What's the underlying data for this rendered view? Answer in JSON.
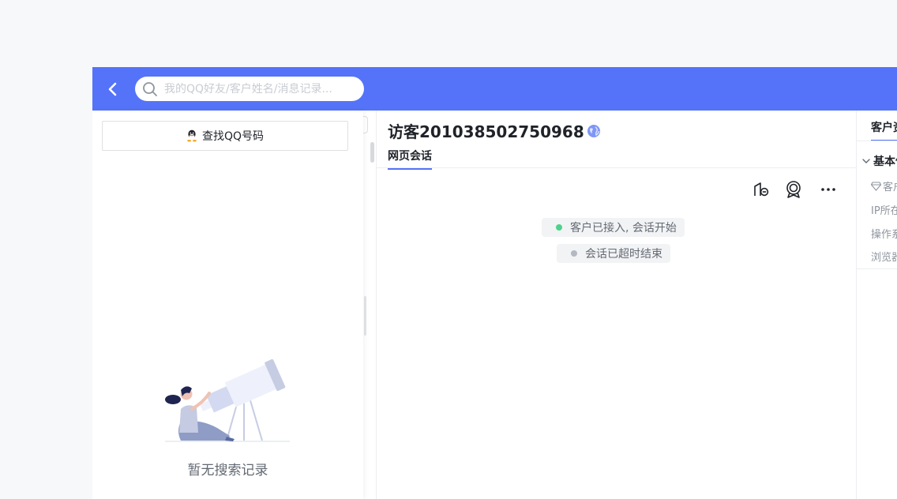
{
  "search": {
    "placeholder": "我的QQ好友/客户姓名/消息记录..."
  },
  "left_panel": {
    "find_qq_label": "查找QQ号码",
    "empty_text": "暂无搜索记录"
  },
  "chat": {
    "visitor_name": "访客201038502750968",
    "tab_label": "网页会话",
    "messages": [
      {
        "text": "客户已接入, 会话开始",
        "dot_color": "#4cd38b"
      },
      {
        "text": "会话已超时结束",
        "dot_color": "#b4b8c3"
      }
    ]
  },
  "right_panel": {
    "tab_label": "客户资料",
    "section_title": "基本信息",
    "rows": [
      "客户",
      "IP所在",
      "操作系",
      "浏览器"
    ]
  },
  "colors": {
    "accent": "#5573f8",
    "page_bg": "#f7f8fa"
  }
}
